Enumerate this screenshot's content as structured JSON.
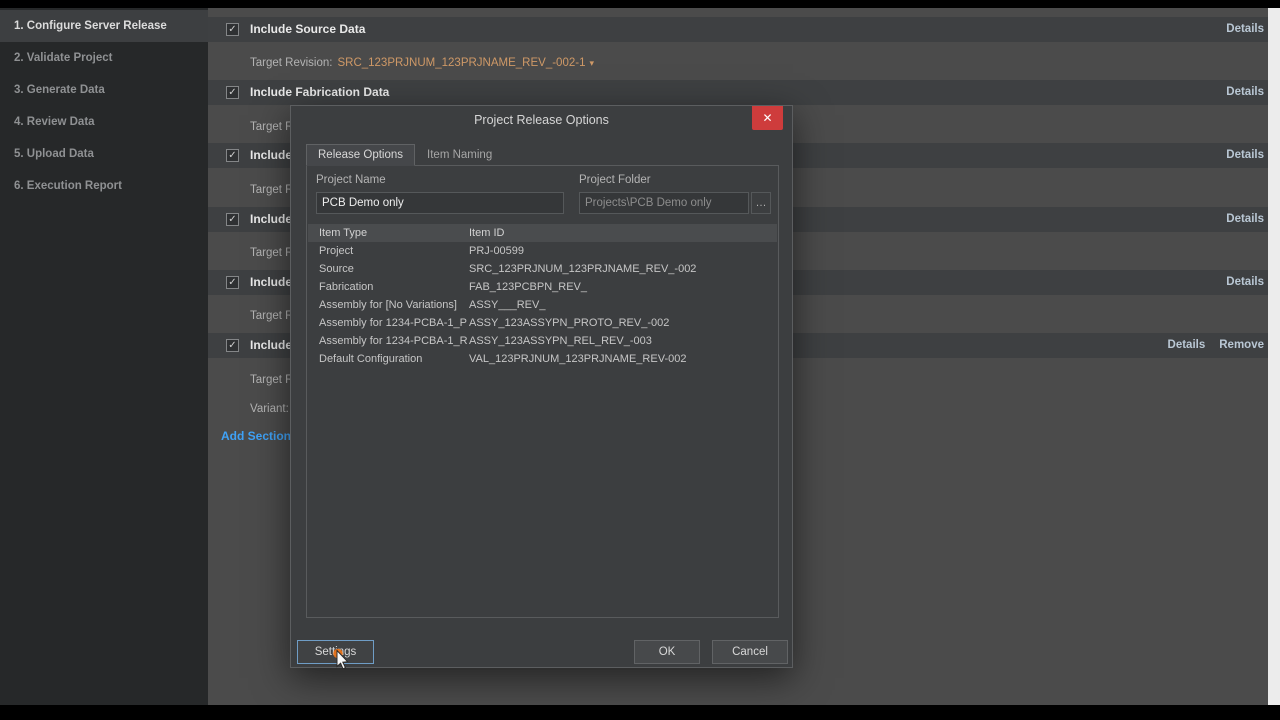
{
  "glyphs": {
    "check": "✓",
    "close": "✕",
    "caret": "▾",
    "ellipsis": "…"
  },
  "colors": {
    "revision_link": "#cf9967",
    "add_section_link": "#3fa2f7",
    "details_link": "#b9c7d4",
    "close_button": "#ce3c3c",
    "click_indicator": "#e8731a",
    "sidebar_bg": "#262829",
    "main_bg": "#4b4b4b",
    "dialog_bg": "#3c3e40"
  },
  "sidebar": {
    "items": [
      {
        "label": "1. Configure Server Release",
        "active": true
      },
      {
        "label": "2. Validate Project",
        "active": false
      },
      {
        "label": "3. Generate Data",
        "active": false
      },
      {
        "label": "4. Review Data",
        "active": false
      },
      {
        "label": "5. Upload Data",
        "active": false
      },
      {
        "label": "6. Execution Report",
        "active": false
      }
    ]
  },
  "main": {
    "details_label": "Details",
    "remove_label": "Remove",
    "variant_label": "Variant:",
    "add_section_label": "Add Section",
    "sections": [
      {
        "title": "Include Source Data",
        "checked": true,
        "target_label": "Target Revision:",
        "target_value": "SRC_123PRJNUM_123PRJNAME_REV_-002-1"
      },
      {
        "title": "Include Fabrication Data",
        "checked": true,
        "target_label": "Target R"
      },
      {
        "title": "Include",
        "checked": true,
        "target_label": "Target R"
      },
      {
        "title": "Include",
        "checked": true,
        "target_label": "Target R"
      },
      {
        "title": "Include",
        "checked": true,
        "target_label": "Target R"
      },
      {
        "title": "Include",
        "checked": true,
        "target_label": "Target R"
      }
    ]
  },
  "dialog": {
    "title": "Project Release Options",
    "tabs": [
      "Release Options",
      "Item Naming"
    ],
    "active_tab": "Release Options",
    "project_name_label": "Project Name",
    "project_name_value": "PCB Demo only",
    "project_folder_label": "Project Folder",
    "project_folder_value": "Projects\\PCB Demo only",
    "table": {
      "headers": [
        "Item Type",
        "Item ID"
      ],
      "rows": [
        [
          "Project",
          "PRJ-00599"
        ],
        [
          "Source",
          "SRC_123PRJNUM_123PRJNAME_REV_-002"
        ],
        [
          "Fabrication",
          "FAB_123PCBPN_REV_"
        ],
        [
          "Assembly for [No Variations]",
          "ASSY___REV_"
        ],
        [
          "Assembly for 1234-PCBA-1_P",
          "ASSY_123ASSYPN_PROTO_REV_-002"
        ],
        [
          "Assembly for 1234-PCBA-1_R",
          "ASSY_123ASSYPN_REL_REV_-003"
        ],
        [
          "Default Configuration",
          "VAL_123PRJNUM_123PRJNAME_REV-002"
        ]
      ]
    },
    "buttons": {
      "settings": "Settings",
      "ok": "OK",
      "cancel": "Cancel"
    }
  }
}
